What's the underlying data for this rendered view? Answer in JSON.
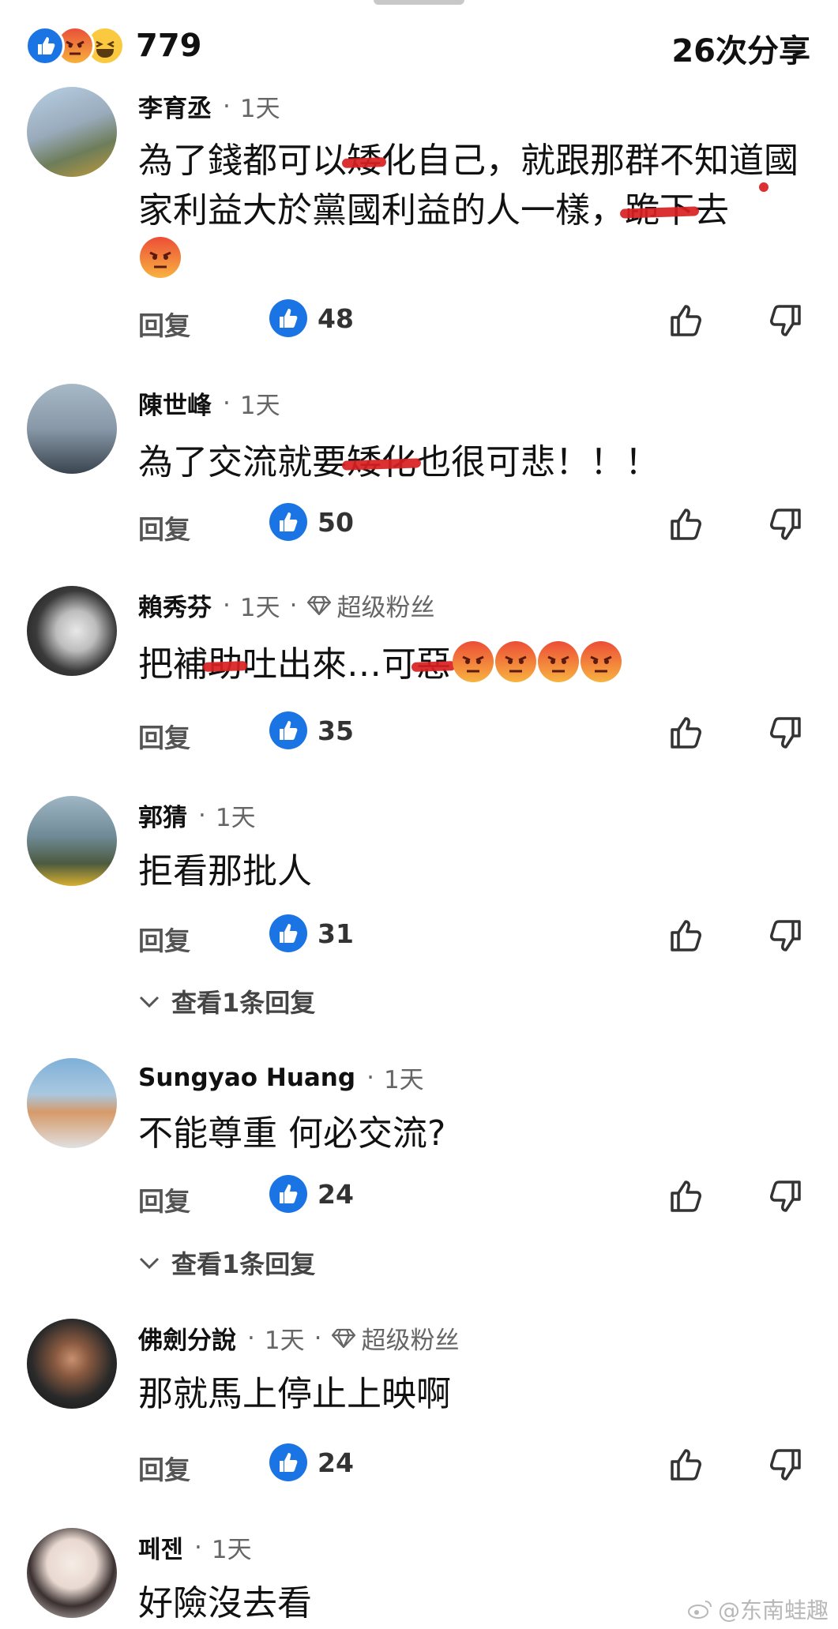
{
  "summary": {
    "reaction_count": "779",
    "shares": "26次分享"
  },
  "comments": [
    {
      "name": "李育丞",
      "time": "1天",
      "text_parts": [
        "為了錢都可以",
        "矮",
        "化自己，就跟那群不知道",
        "國家利益大於黨國利益",
        "的人一樣，",
        "跪下",
        "去"
      ],
      "likes": "48",
      "avatar_colors": [
        "#a8c4dc",
        "#7a8a6a"
      ]
    },
    {
      "name": "陳世峰",
      "time": "1天",
      "text_parts": [
        "為了交流就要",
        "矮化",
        "也很可悲！！！"
      ],
      "likes": "50",
      "avatar_colors": [
        "#9fb0c0",
        "#3d4a56"
      ]
    },
    {
      "name": "賴秀芬",
      "time": "1天",
      "badge": "超级粉丝",
      "text_parts": [
        "把補",
        "助",
        "吐出來…可",
        "惡"
      ],
      "likes": "35",
      "avatar_colors": [
        "#d8d8d8",
        "#333333"
      ]
    },
    {
      "name": "郭猜",
      "time": "1天",
      "text": "拒看那批人",
      "likes": "31",
      "replies": "查看1条回复",
      "avatar_colors": [
        "#8aa8b8",
        "#5a6d48"
      ]
    },
    {
      "name": "Sungyao Huang",
      "time": "1天",
      "text": "不能尊重 何必交流?",
      "likes": "24",
      "replies": "查看1条回复",
      "avatar_colors": [
        "#8fb7d8",
        "#d9a070"
      ]
    },
    {
      "name": "佛劍分說",
      "time": "1天",
      "badge": "超级粉丝",
      "text": "那就馬上停止上映啊",
      "likes": "24",
      "avatar_colors": [
        "#2a2a2a",
        "#8a5a40"
      ]
    },
    {
      "name": "페젠",
      "time": "1天",
      "text": "好險沒去看",
      "avatar_colors": [
        "#f2e8e4",
        "#2a2626"
      ]
    }
  ],
  "labels": {
    "reply": "回复",
    "sep": "·"
  },
  "watermark": "@东南蛙趣",
  "colors": {
    "like_blue": "#1b74e4",
    "strike_red": "#d81f21"
  }
}
